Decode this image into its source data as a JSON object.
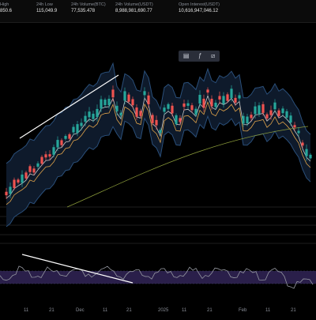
{
  "header": {
    "stats": [
      {
        "label": "High",
        "value": "850.6"
      },
      {
        "label": "24h Low",
        "value": "115,049.9"
      },
      {
        "label": "24h Volume(BTC)",
        "value": "77,535.478"
      },
      {
        "label": "24h Volume(USDT)",
        "value": "8,988,981,690.77"
      },
      {
        "label": "Open Interest(USDT)",
        "value": "10,616,947,046.12"
      }
    ]
  },
  "toolbar": {
    "icons": [
      "chart-style-icon",
      "indicator-icon",
      "drawing-icon"
    ]
  },
  "x_axis": {
    "ticks": [
      "11",
      "21",
      "Dec",
      "11",
      "21",
      "2025",
      "11",
      "21",
      "Feb",
      "11",
      "21"
    ]
  },
  "colors": {
    "up": "#26a69a",
    "down": "#ef5350",
    "band": "#2a4f7a",
    "rsi_line": "#9598a1",
    "rsi_band": "#2a1f4a"
  }
}
